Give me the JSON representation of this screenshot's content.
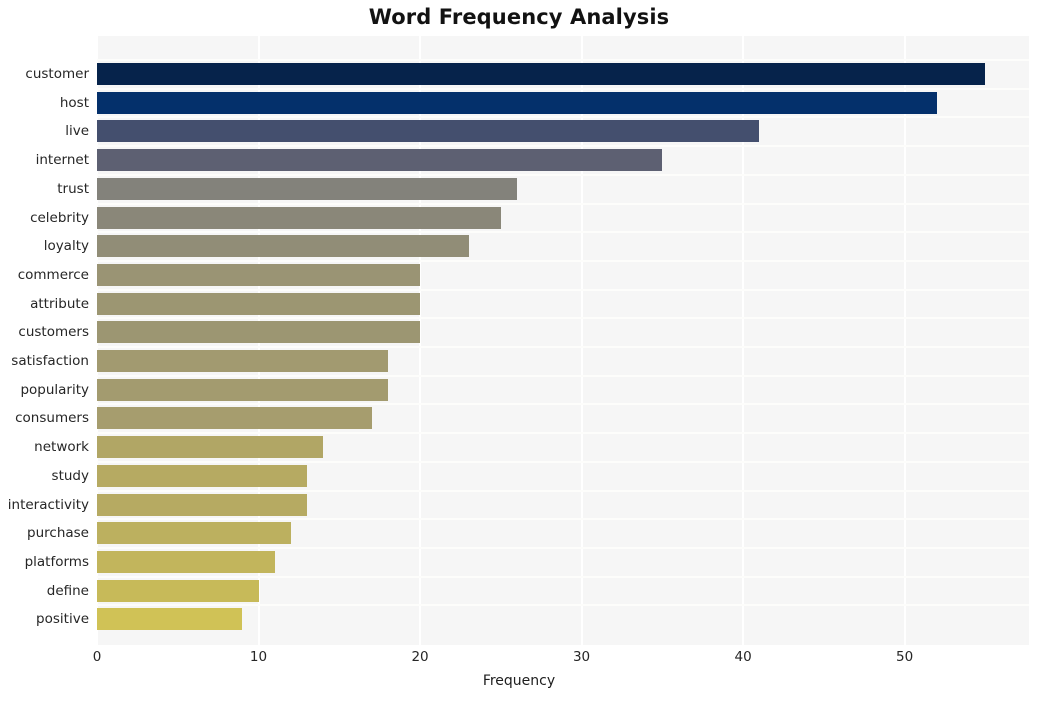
{
  "chart_data": {
    "type": "bar",
    "orientation": "horizontal",
    "title": "Word Frequency Analysis",
    "xlabel": "Frequency",
    "ylabel": "",
    "xlim": [
      0,
      57.7
    ],
    "xticks": [
      0,
      10,
      20,
      30,
      40,
      50
    ],
    "xtick_labels": [
      "0",
      "10",
      "20",
      "30",
      "40",
      "50"
    ],
    "grid": true,
    "legend": "none",
    "plot_background": "#f6f6f6",
    "gridline_color": "#ffffff",
    "categories": [
      "customer",
      "host",
      "live",
      "internet",
      "trust",
      "celebrity",
      "loyalty",
      "commerce",
      "attribute",
      "customers",
      "satisfaction",
      "popularity",
      "consumers",
      "network",
      "study",
      "interactivity",
      "purchase",
      "platforms",
      "define",
      "positive"
    ],
    "values": [
      55,
      52,
      41,
      35,
      26,
      25,
      23,
      20,
      20,
      20,
      18,
      18,
      17,
      14,
      13,
      13,
      12,
      11,
      10,
      9
    ],
    "bar_colors": [
      "#06234b",
      "#04306b",
      "#444f6e",
      "#5d6072",
      "#83827b",
      "#8a8779",
      "#918d77",
      "#9a9474",
      "#9c9672",
      "#9c9672",
      "#a29a70",
      "#a39b6f",
      "#a69d6e",
      "#b1a665",
      "#b6aa62",
      "#b6aa62",
      "#bcb05f",
      "#c2b55c",
      "#c7ba59",
      "#d0c256"
    ]
  }
}
